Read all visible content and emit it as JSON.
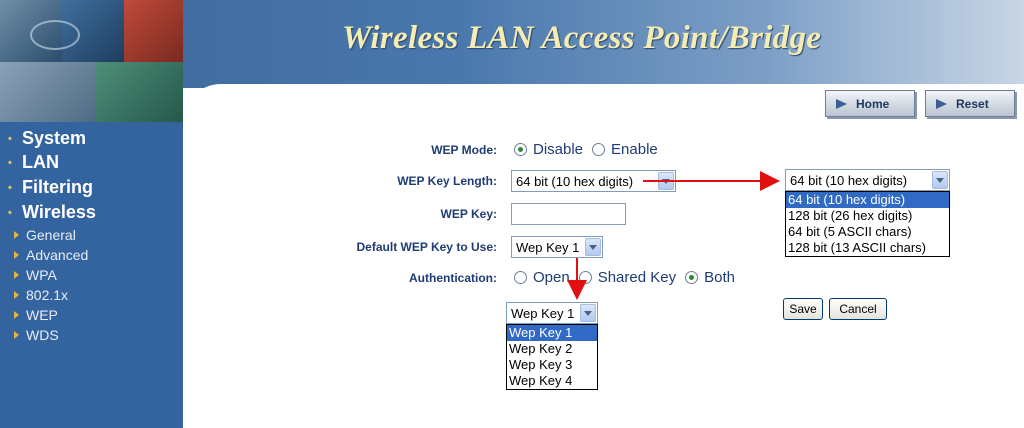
{
  "header": {
    "title": "Wireless LAN Access Point/Bridge"
  },
  "top_buttons": {
    "home": "Home",
    "reset": "Reset"
  },
  "sidebar": {
    "main_items": [
      "System",
      "LAN",
      "Filtering",
      "Wireless"
    ],
    "sub_items": [
      "General",
      "Advanced",
      "WPA",
      "802.1x",
      "WEP",
      "WDS"
    ]
  },
  "form": {
    "wep_mode": {
      "label": "WEP Mode:",
      "options": [
        "Disable",
        "Enable"
      ],
      "selected": "Disable"
    },
    "key_length": {
      "label": "WEP Key Length:",
      "value": "64 bit (10 hex digits)"
    },
    "wep_key": {
      "label": "WEP Key:",
      "value": ""
    },
    "default_key": {
      "label": "Default WEP Key to Use:",
      "value": "Wep Key 1"
    },
    "authentication": {
      "label": "Authentication:",
      "options": [
        "Open",
        "Shared Key",
        "Both"
      ],
      "selected": "Both"
    }
  },
  "key_length_dropdown": {
    "value": "64 bit (10 hex digits)",
    "options": [
      "64 bit (10 hex digits)",
      "128 bit (26 hex digits)",
      "64 bit (5 ASCII chars)",
      "128 bit (13 ASCII chars)"
    ],
    "highlighted": "64 bit (10 hex digits)"
  },
  "default_key_dropdown": {
    "value": "Wep Key 1",
    "options": [
      "Wep Key 1",
      "Wep Key 2",
      "Wep Key 3",
      "Wep Key 4"
    ],
    "highlighted": "Wep Key 1"
  },
  "actions": {
    "save": "Save",
    "cancel": "Cancel"
  },
  "colors": {
    "annotation_arrow": "#e01010",
    "sidebar": "#3464a0",
    "title": "#f4ecb0",
    "label": "#1f3c74"
  }
}
